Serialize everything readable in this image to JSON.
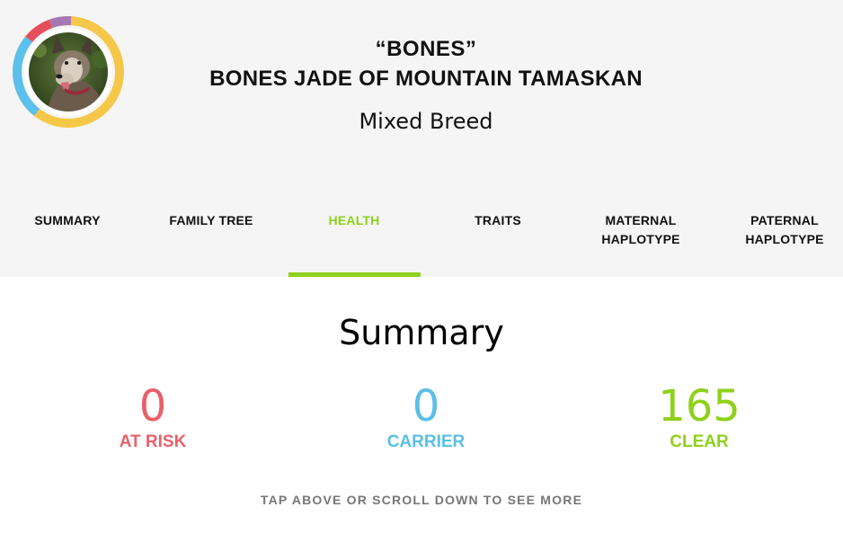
{
  "dog": {
    "nickname": "“BONES”",
    "full_name": "BONES JADE OF MOUNTAIN TAMASKAN",
    "breed": "Mixed Breed",
    "avatar_icon": "dog-photo",
    "ring_colors": [
      "#f5c84a",
      "#5bc0eb",
      "#e84d5c",
      "#a777b4"
    ]
  },
  "tabs": [
    {
      "label": "SUMMARY",
      "active": false
    },
    {
      "label": "FAMILY TREE",
      "active": false
    },
    {
      "label": "HEALTH",
      "active": true
    },
    {
      "label": "TRAITS",
      "active": false
    },
    {
      "label": "MATERNAL HAPLOTYPE",
      "active": false
    },
    {
      "label": "PATERNAL HAPLOTYPE",
      "active": false
    }
  ],
  "summary": {
    "title": "Summary",
    "at_risk": {
      "value": "0",
      "label": "AT RISK",
      "color": "#e8606a"
    },
    "carrier": {
      "value": "0",
      "label": "CARRIER",
      "color": "#5bbfe6"
    },
    "clear": {
      "value": "165",
      "label": "CLEAR",
      "color": "#8fd01b"
    }
  },
  "hint": "TAP ABOVE OR SCROLL DOWN TO SEE MORE",
  "colors": {
    "accent": "#8fd01b",
    "header_bg": "#f5f5f5"
  }
}
